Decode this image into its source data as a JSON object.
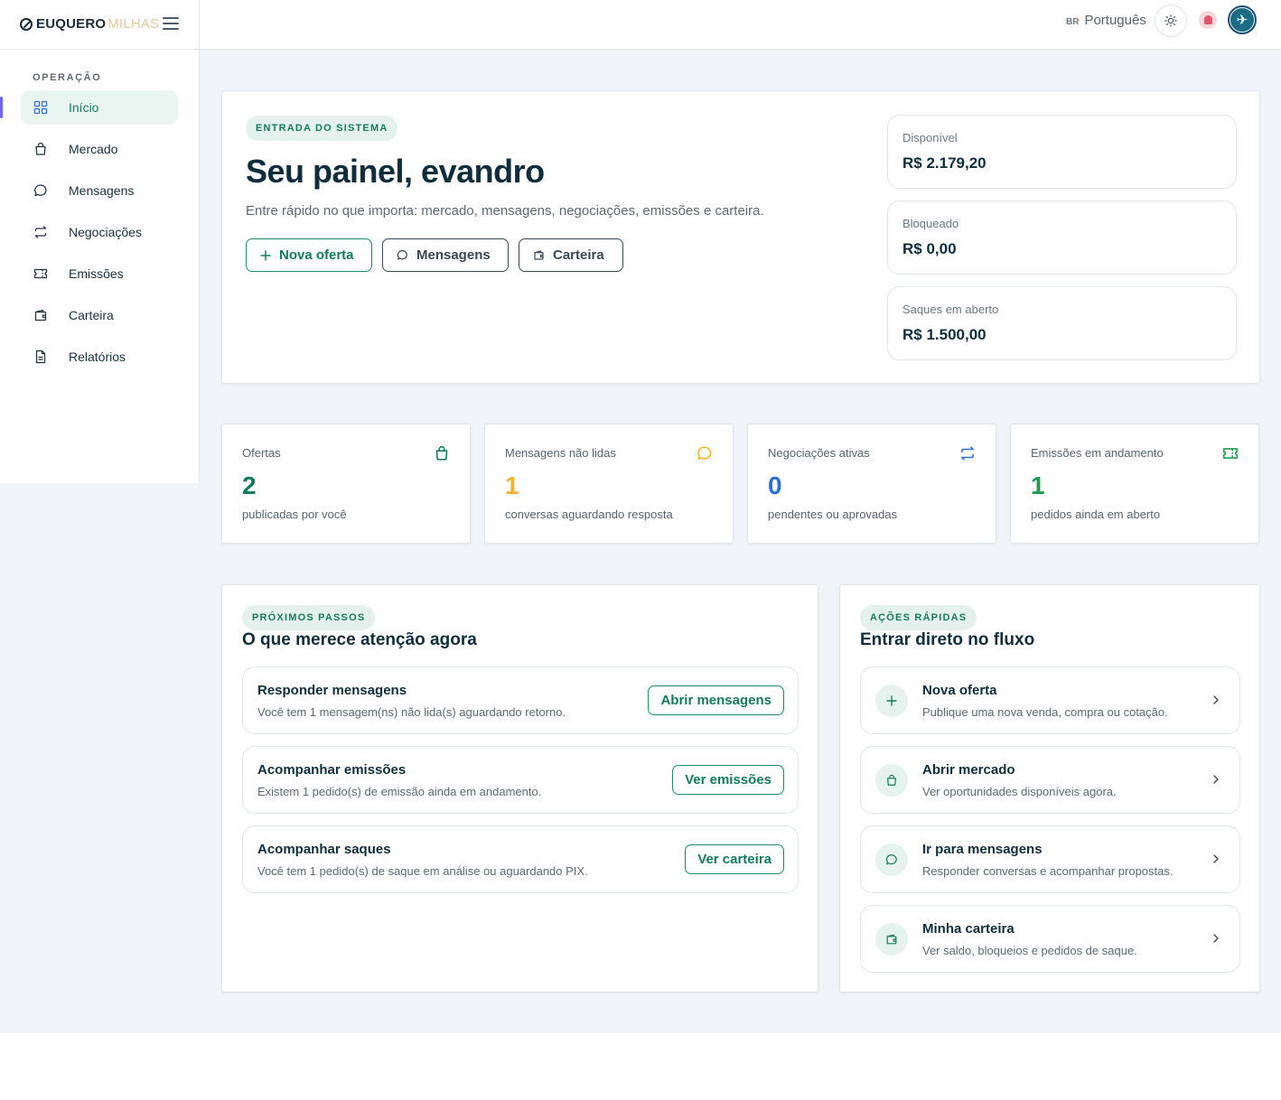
{
  "header": {
    "brand_bold": "EUQUERO",
    "brand_light": "MILHAS",
    "lang_flag": "BR",
    "lang_name": "Português"
  },
  "sidebar": {
    "section": "OPERAÇÃO",
    "items": [
      {
        "label": "Início",
        "icon": "grid-icon"
      },
      {
        "label": "Mercado",
        "icon": "shopping-bag-icon"
      },
      {
        "label": "Mensagens",
        "icon": "chat-icon"
      },
      {
        "label": "Negociações",
        "icon": "exchange-icon"
      },
      {
        "label": "Emissões",
        "icon": "ticket-icon"
      },
      {
        "label": "Carteira",
        "icon": "wallet-icon"
      },
      {
        "label": "Relatórios",
        "icon": "document-icon"
      }
    ]
  },
  "hero": {
    "pill": "ENTRADA DO SISTEMA",
    "title": "Seu painel, evandro",
    "subtitle": "Entre rápido no que importa: mercado, mensagens, negociações, emissões e carteira.",
    "buttons": {
      "new_offer": "Nova oferta",
      "messages": "Mensagens",
      "wallet": "Carteira"
    },
    "balances": [
      {
        "label": "Disponível",
        "value": "R$ 2.179,20"
      },
      {
        "label": "Bloqueado",
        "value": "R$ 0,00"
      },
      {
        "label": "Saques em aberto",
        "value": "R$ 1.500,00"
      }
    ]
  },
  "stats": [
    {
      "label": "Ofertas",
      "value": "2",
      "desc": "publicadas por você",
      "color": "#157a5c",
      "icon": "shopping-bag-icon"
    },
    {
      "label": "Mensagens não lidas",
      "value": "1",
      "desc": "conversas aguardando resposta",
      "color": "#f0b429",
      "icon": "chat-icon"
    },
    {
      "label": "Negociações ativas",
      "value": "0",
      "desc": "pendentes ou aprovadas",
      "color": "#2f6fd1",
      "icon": "exchange-icon"
    },
    {
      "label": "Emissões em andamento",
      "value": "1",
      "desc": "pedidos ainda em aberto",
      "color": "#1f9a4f",
      "icon": "ticket-icon"
    }
  ],
  "next_steps": {
    "pill": "PRÓXIMOS PASSOS",
    "title": "O que merece atenção agora",
    "items": [
      {
        "title": "Responder mensagens",
        "desc": "Você tem 1 mensagem(ns) não lida(s) aguardando retorno.",
        "button": "Abrir mensagens"
      },
      {
        "title": "Acompanhar emissões",
        "desc": "Existem 1 pedido(s) de emissão ainda em andamento.",
        "button": "Ver emissões"
      },
      {
        "title": "Acompanhar saques",
        "desc": "Você tem 1 pedido(s) de saque em análise ou aguardando PIX.",
        "button": "Ver carteira"
      }
    ]
  },
  "quick_actions": {
    "pill": "AÇÕES RÁPIDAS",
    "title": "Entrar direto no fluxo",
    "items": [
      {
        "title": "Nova oferta",
        "desc": "Publique uma nova venda, compra ou cotação.",
        "icon": "plus-icon"
      },
      {
        "title": "Abrir mercado",
        "desc": "Ver oportunidades disponíveis agora.",
        "icon": "shopping-bag-icon"
      },
      {
        "title": "Ir para mensagens",
        "desc": "Responder conversas e acompanhar propostas.",
        "icon": "chat-icon"
      },
      {
        "title": "Minha carteira",
        "desc": "Ver saldo, bloqueios e pedidos de saque.",
        "icon": "wallet-icon"
      }
    ]
  }
}
